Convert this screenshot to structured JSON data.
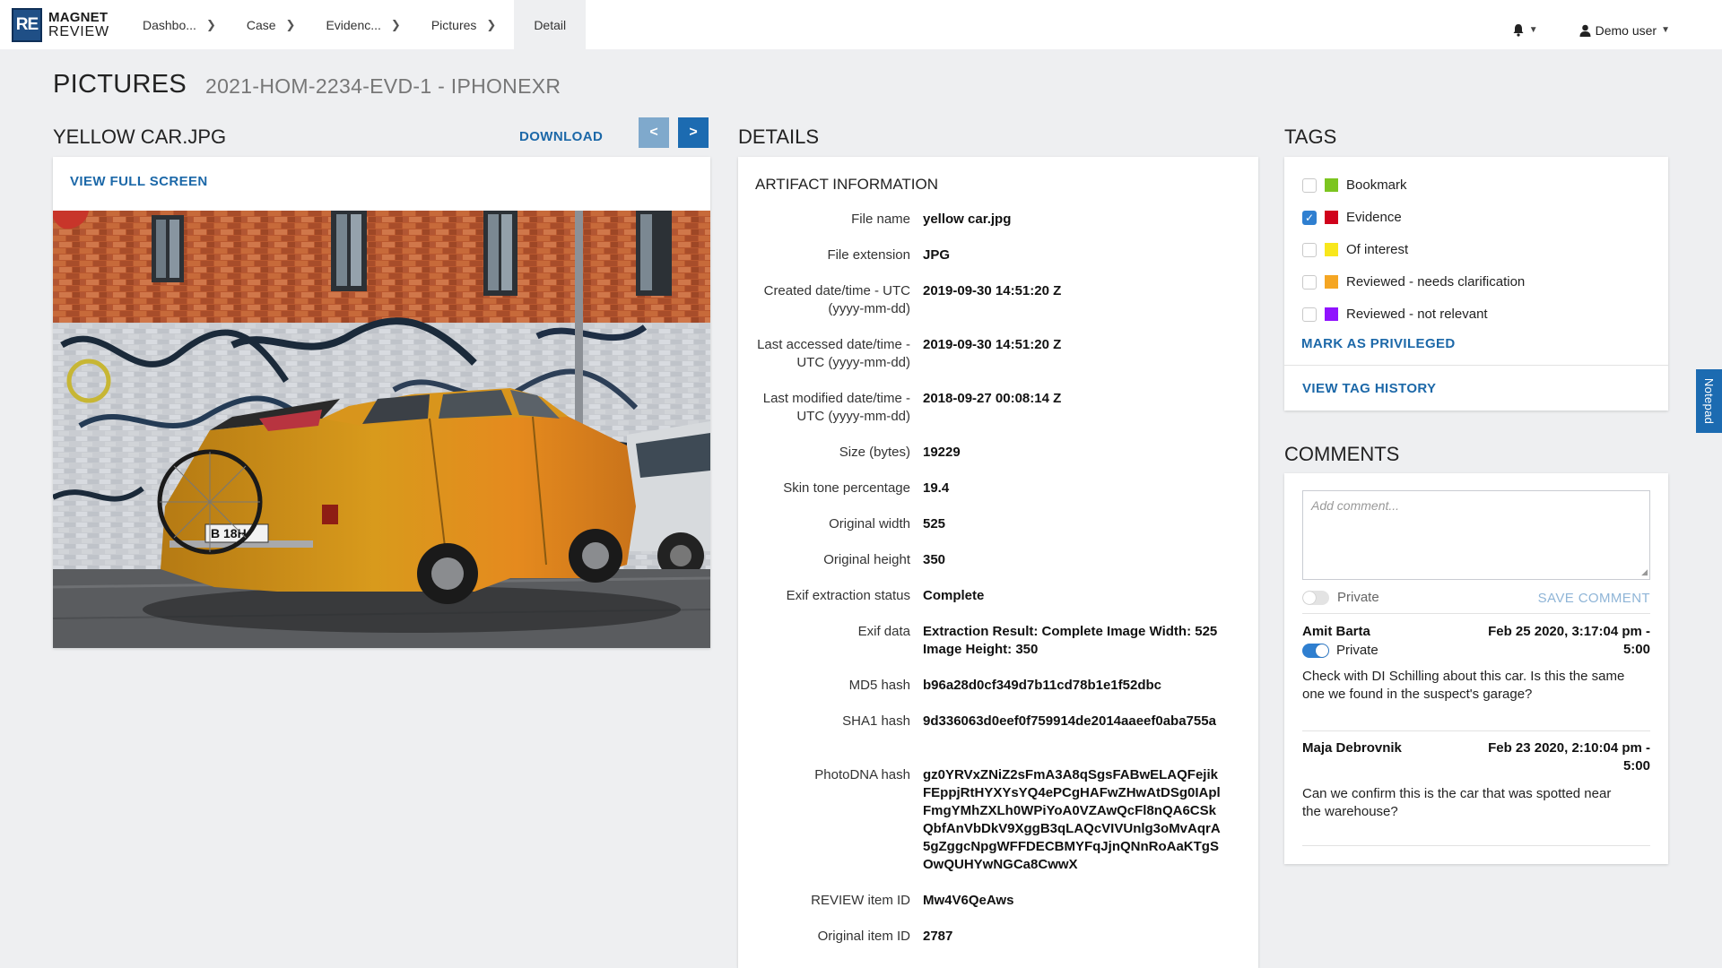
{
  "app": {
    "logo_mark": "RE",
    "logo_line1": "MAGNET",
    "logo_line2": "REVIEW"
  },
  "breadcrumbs": [
    {
      "label": "Dashbo..."
    },
    {
      "label": "Case"
    },
    {
      "label": "Evidenc..."
    },
    {
      "label": "Pictures"
    },
    {
      "label": "Detail"
    }
  ],
  "header": {
    "user_label": "Demo user"
  },
  "page": {
    "title": "PICTURES",
    "subtitle": "2021-HOM-2234-EVD-1 - IPHONEXR"
  },
  "picture": {
    "title": "YELLOW CAR.JPG",
    "download_label": "DOWNLOAD",
    "prev_label": "<",
    "next_label": ">",
    "view_full_screen_label": "VIEW FULL SCREEN",
    "plate_text": "B 18H"
  },
  "details": {
    "title": "DETAILS",
    "section_title": "ARTIFACT INFORMATION",
    "rows": [
      {
        "label": "File name",
        "value": "yellow car.jpg"
      },
      {
        "label": "File extension",
        "value": "JPG"
      },
      {
        "label": "Created date/time - UTC (yyyy-mm-dd)",
        "value": "2019-09-30 14:51:20 Z"
      },
      {
        "label": "Last accessed date/time - UTC (yyyy-mm-dd)",
        "value": "2019-09-30 14:51:20 Z"
      },
      {
        "label": "Last modified date/time - UTC (yyyy-mm-dd)",
        "value": "2018-09-27 00:08:14 Z"
      },
      {
        "label": "Size (bytes)",
        "value": "19229"
      },
      {
        "label": "Skin tone percentage",
        "value": "19.4"
      },
      {
        "label": "Original width",
        "value": "525"
      },
      {
        "label": "Original height",
        "value": "350"
      },
      {
        "label": "Exif extraction status",
        "value": "Complete"
      },
      {
        "label": "Exif data",
        "value": "Extraction Result: Complete Image Width: 525 Image Height: 350"
      },
      {
        "label": "MD5 hash",
        "value": "b96a28d0cf349d7b11cd78b1e1f52dbc"
      },
      {
        "label": "SHA1 hash",
        "value": "9d336063d0eef0f759914de2014aaeef0aba755a"
      },
      {
        "label": "PhotoDNA hash",
        "value": "gz0YRVxZNiZ2sFmA3A8qSgsFABwELAQFejikFEppjRtHYXYsYQ4ePCgHAFwZHwAtDSg0IAplFmgYMhZXLh0WPiYoA0VZAwQcFl8nQA6CSkQbfAnVbDkV9XggB3qLAQcVIVUnlg3oMvAqrA5gZggcNpgWFFDECBMYFqJjnQNnRoAaKTgSOwQUHYwNGCa8CwwX"
      },
      {
        "label": "REVIEW item ID",
        "value": "Mw4V6QeAws"
      },
      {
        "label": "Original item ID",
        "value": "2787"
      }
    ]
  },
  "tags": {
    "title": "TAGS",
    "items": [
      {
        "label": "Bookmark",
        "color": "#7cc520",
        "checked": false
      },
      {
        "label": "Evidence",
        "color": "#d0021b",
        "checked": true
      },
      {
        "label": "Of interest",
        "color": "#f8e71c",
        "checked": false
      },
      {
        "label": "Reviewed - needs clarification",
        "color": "#f5a623",
        "checked": false
      },
      {
        "label": "Reviewed - not relevant",
        "color": "#9013fe",
        "checked": false
      }
    ],
    "mark_privileged_label": "MARK AS PRIVILEGED",
    "view_tag_history_label": "VIEW TAG HISTORY"
  },
  "comments": {
    "title": "COMMENTS",
    "placeholder": "Add comment...",
    "private_label": "Private",
    "save_label": "SAVE COMMENT",
    "items": [
      {
        "author": "Amit Barta",
        "date": "Feb 25 2020, 3:17:04 pm - 5:00",
        "private_label": "Private",
        "text": "Check with DI Schilling about this car. Is this the same one we found in the suspect's garage?"
      },
      {
        "author": "Maja Debrovnik",
        "date": "Feb 23 2020, 2:10:04 pm - 5:00",
        "text": "Can we confirm this is the car that was spotted near the warehouse?"
      }
    ]
  },
  "notepad_label": "Notepad",
  "colors": {
    "accent": "#1c68a8",
    "nav_active": "#1c6bb1",
    "nav_inactive": "#7fa9cc"
  }
}
